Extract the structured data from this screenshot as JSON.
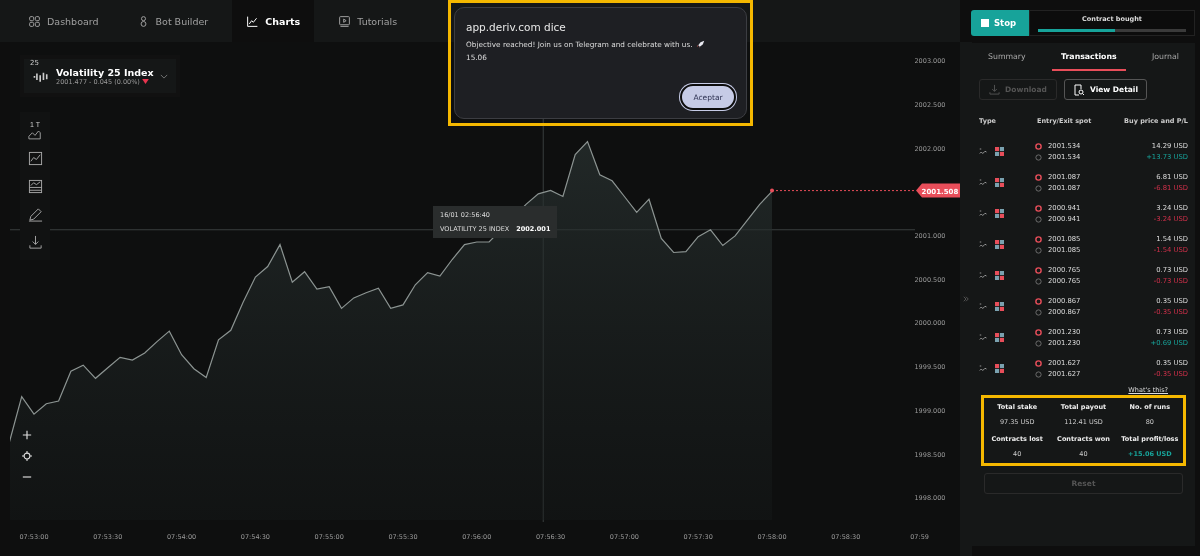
{
  "nav": {
    "tabs": [
      {
        "label": "Dashboard",
        "selected": false
      },
      {
        "label": "Bot Builder",
        "selected": false
      },
      {
        "label": "Charts",
        "selected": true
      },
      {
        "label": "Tutorials",
        "selected": false
      }
    ]
  },
  "chart": {
    "symbol": {
      "badge": "25",
      "name": "Volatility 25 Index",
      "quote": "2001.477 - 0.045 (0.00%)",
      "falling": true
    },
    "chart_type_label": "1 T",
    "tooltip": {
      "time": "16/01 02:56:40",
      "name": "VOLATILITY 25 INDEX",
      "value": "2002.001"
    },
    "chart_data": {
      "type": "area",
      "categories": [
        null,
        null,
        "07:53:00",
        null,
        null,
        null,
        null,
        null,
        "07:53:30",
        null,
        null,
        null,
        null,
        null,
        "07:54:00",
        null,
        null,
        null,
        null,
        null,
        "07:54:30",
        null,
        null,
        null,
        null,
        null,
        "07:55:00",
        null,
        null,
        null,
        null,
        null,
        "07:55:30",
        null,
        null,
        null,
        null,
        null,
        "07:56:00",
        null,
        null,
        null,
        null,
        null,
        "07:56:30",
        null,
        null,
        null,
        null,
        null,
        "07:57:00",
        null,
        null,
        null,
        null,
        null,
        "07:57:30",
        null,
        null,
        null,
        null,
        null,
        "07:58:00",
        null,
        null,
        null,
        null,
        null,
        "07:58:30",
        null,
        null,
        null,
        null,
        null,
        "07:59"
      ],
      "series": [
        {
          "color": "#8c9492",
          "values": [
            1998.63,
            1999.15,
            1998.95,
            1999.07,
            1999.1,
            1999.44,
            1999.51,
            1999.36,
            1999.48,
            1999.6,
            1999.57,
            1999.65,
            1999.78,
            1999.9,
            1999.63,
            1999.47,
            1999.37,
            1999.8,
            1999.91,
            2000.23,
            2000.52,
            2000.64,
            2000.89,
            2000.46,
            2000.58,
            2000.38,
            2000.41,
            2000.16,
            2000.28,
            2000.34,
            2000.39,
            2000.16,
            2000.2,
            2000.43,
            2000.57,
            2000.53,
            2000.72,
            2000.89,
            2000.92,
            2000.92,
            null,
            null,
            2001.35,
            2001.47,
            2001.51,
            2001.44,
            2001.92,
            2002.07,
            2001.69,
            2001.62,
            2001.44,
            2001.26,
            2001.41,
            2000.96,
            2000.8,
            2000.81,
            2000.98,
            2001.06,
            2000.88,
            2000.99,
            2001.17,
            2001.35,
            2001.5,
            null,
            null,
            null,
            null,
            null,
            null,
            null,
            null,
            null,
            null,
            null,
            null
          ]
        }
      ],
      "ylim": [
        1998,
        2003
      ],
      "yticks": [
        {
          "value": 1998,
          "label": "1998.000"
        },
        {
          "value": 1998.5,
          "label": "1998.500"
        },
        {
          "value": 1999,
          "label": "1999.000"
        },
        {
          "value": 1999.5,
          "label": "1999.500"
        },
        {
          "value": 2000,
          "label": "2000.000"
        },
        {
          "value": 2000.5,
          "label": "2000.500"
        },
        {
          "value": 2001,
          "label": "2001.000"
        },
        {
          "value": 2002,
          "label": "2002.000"
        },
        {
          "value": 2002.5,
          "label": "2002.500"
        },
        {
          "value": 2003,
          "label": "2003.000"
        }
      ],
      "ref_lines": [
        {
          "axis": "y",
          "value": 2001.06
        },
        {
          "axis": "y",
          "value": 2001.508,
          "label": "2001.508"
        }
      ]
    }
  },
  "dialog": {
    "highlighted": true,
    "title": "app.deriv.com dice",
    "message": "Objective reached! Join us on Telegram and celebrate with us.",
    "amount": "15.06",
    "button": "Aceptar"
  },
  "run": {
    "stop_label": "Stop",
    "status": "Contract bought",
    "level": 0.52
  },
  "panel": {
    "tabs": [
      {
        "label": "Summary",
        "selected": false
      },
      {
        "label": "Transactions",
        "selected": true
      },
      {
        "label": "Journal",
        "selected": false
      }
    ],
    "download": {
      "label": "Download",
      "disabled": true
    },
    "view_detail": {
      "label": "View Detail",
      "disabled": false
    },
    "columns": [
      "Type",
      "Entry/Exit spot",
      "Buy price and P/L"
    ],
    "rows": [
      {
        "entry": "2001.534",
        "exit": "2001.534",
        "buy": "14.29 USD",
        "pl": "+13.73 USD",
        "won": true
      },
      {
        "entry": "2001.087",
        "exit": "2001.087",
        "buy": "6.81 USD",
        "pl": "-6.81 USD",
        "won": false
      },
      {
        "entry": "2000.941",
        "exit": "2000.941",
        "buy": "3.24 USD",
        "pl": "-3.24 USD",
        "won": false
      },
      {
        "entry": "2001.085",
        "exit": "2001.085",
        "buy": "1.54 USD",
        "pl": "-1.54 USD",
        "won": false
      },
      {
        "entry": "2000.765",
        "exit": "2000.765",
        "buy": "0.73 USD",
        "pl": "-0.73 USD",
        "won": false
      },
      {
        "entry": "2000.867",
        "exit": "2000.867",
        "buy": "0.35 USD",
        "pl": "-0.35 USD",
        "won": false
      },
      {
        "entry": "2001.230",
        "exit": "2001.230",
        "buy": "0.73 USD",
        "pl": "+0.69 USD",
        "won": true
      },
      {
        "entry": "2001.627",
        "exit": "2001.627",
        "buy": "0.35 USD",
        "pl": "-0.35 USD",
        "won": false
      }
    ],
    "whats_this": "What's this?",
    "stats": {
      "highlighted": true,
      "items": [
        {
          "label": "Total stake",
          "value": "97.35 USD",
          "profit": false
        },
        {
          "label": "Total payout",
          "value": "112.41 USD",
          "profit": false
        },
        {
          "label": "No. of runs",
          "value": "80",
          "profit": false
        },
        {
          "label": "Contracts lost",
          "value": "40",
          "profit": false
        },
        {
          "label": "Contracts won",
          "value": "40",
          "profit": false
        },
        {
          "label": "Total profit/loss",
          "value": "+15.06 USD",
          "profit": true
        }
      ]
    },
    "reset": {
      "label": "Reset",
      "disabled": true
    }
  }
}
